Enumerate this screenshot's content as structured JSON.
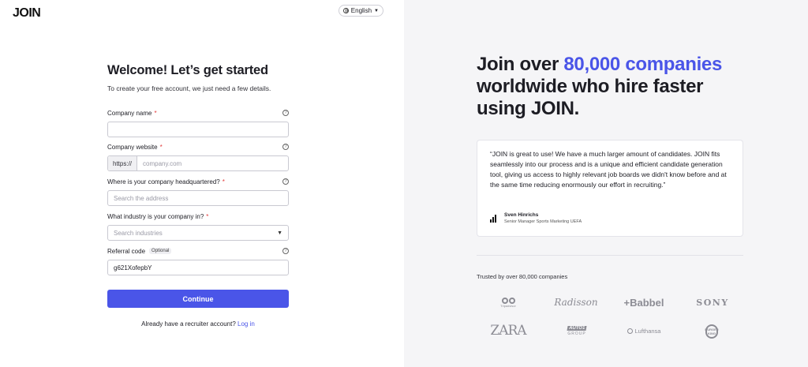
{
  "header": {
    "logo": "JOIN",
    "language": "English"
  },
  "form": {
    "title": "Welcome! Let’s get started",
    "subtitle": "To create your free account, we just need a few details.",
    "fields": {
      "company_name": {
        "label": "Company name",
        "required_mark": "*",
        "value": ""
      },
      "company_website": {
        "label": "Company website",
        "required_mark": "*",
        "prefix": "https://",
        "placeholder": "company.com"
      },
      "headquarters": {
        "label": "Where is your company headquartered?",
        "required_mark": "*",
        "placeholder": "Search the address"
      },
      "industry": {
        "label": "What industry is your company in?",
        "required_mark": "*",
        "placeholder": "Search industries"
      },
      "referral": {
        "label": "Referral code",
        "optional_badge": "Optional",
        "value": "g621XofepbY"
      }
    },
    "help_glyph": "?",
    "continue_label": "Continue",
    "login_prompt": "Already have a recruiter account?",
    "login_link": "Log in"
  },
  "promo": {
    "headline_pre": "Join over ",
    "headline_highlight": "80,000 companies",
    "headline_post": " worldwide who hire faster using JOIN.",
    "testimonial": {
      "quote": "“JOIN is great to use! We have a much larger amount of candidates. JOIN fits seamlessly into our process and is a unique and efficient candidate generation tool, giving us access to highly relevant job boards we didn't know before and at the same time reducing enormously our effort in recruiting.”",
      "author_name": "Sven Hinrichs",
      "author_role": "Senior Manager Sports Marketing UEFA",
      "author_logo": "adidas-logo"
    },
    "trusted_label": "Trusted by over 80,000 companies",
    "brands": {
      "tripadvisor": "Tripadvisor",
      "radisson": "Radisson",
      "babbel": "+Babbel",
      "sony": "SONY",
      "zara": "ZARA",
      "auto1_top": "AUTO1",
      "auto1_bottom": "GROUP",
      "lufthansa": "Lufthansa",
      "burgerking_top": "BURGER",
      "burgerking_bottom": "KING"
    }
  },
  "colors": {
    "accent": "#4a55e8",
    "required": "#e23b3b",
    "right_bg": "#f5f5f7"
  }
}
